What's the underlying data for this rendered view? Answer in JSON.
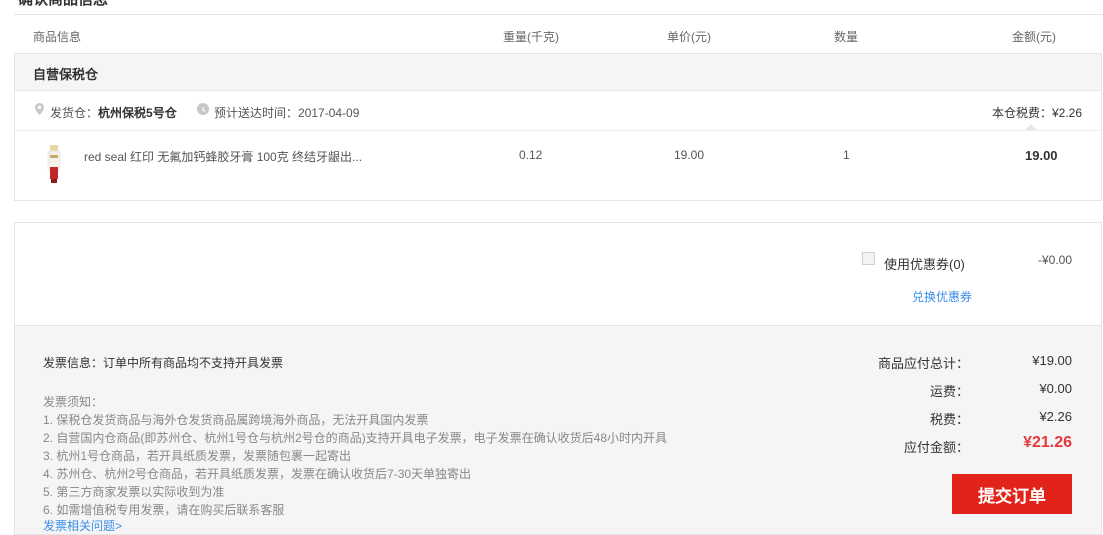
{
  "section": {
    "title": "确认商品信息"
  },
  "columns": {
    "product": "商品信息",
    "weight": "重量(千克)",
    "price": "单价(元)",
    "qty": "数量",
    "amount": "金额(元)"
  },
  "warehouse": {
    "name": "自营保税仓",
    "ship_from_label": "发货仓：",
    "ship_from_value": "杭州保税5号仓",
    "eta_label": "预计送达时间：",
    "eta_value": "2017-04-09",
    "tax_label": "本仓税费：",
    "tax_value": "¥2.26"
  },
  "product": {
    "name": "red seal 红印 无氟加钙蜂胶牙膏 100克 终结牙龈出...",
    "weight": "0.12",
    "price": "19.00",
    "qty": "1",
    "amount": "19.00"
  },
  "coupon": {
    "label": "使用优惠券(0)",
    "value": "-¥0.00",
    "exchange": "兑换优惠券"
  },
  "invoice": {
    "info": "发票信息：订单中所有商品均不支持开具发票",
    "notice_title": "发票须知：",
    "notices": [
      "1. 保税仓发货商品与海外仓发货商品属跨境海外商品，无法开具国内发票",
      "2. 自营国内仓商品(即苏州仓、杭州1号仓与杭州2号仓的商品)支持开具电子发票，电子发票在确认收货后48小时内开具",
      "3. 杭州1号仓商品，若开具纸质发票，发票随包裹一起寄出",
      "4. 苏州仓、杭州2号仓商品，若开具纸质发票，发票在确认收货后7-30天单独寄出",
      "5. 第三方商家发票以实际收到为准",
      "6. 如需增值税专用发票，请在购买后联系客服"
    ],
    "link": "发票相关问题>"
  },
  "summary": {
    "goods_label": "商品应付总计：",
    "goods_value": "¥19.00",
    "shipping_label": "运费：",
    "shipping_value": "¥0.00",
    "tax_label": "税费：",
    "tax_value": "¥2.26",
    "due_label": "应付金额：",
    "due_value": "¥21.26"
  },
  "submit_label": "提交订单",
  "colors": {
    "accent_red": "#e2231a",
    "price_red": "#e4393c",
    "link_blue": "#3a8ee6"
  },
  "icons": {
    "location": "location-pin-icon",
    "time": "clock-icon",
    "checkbox": "checkbox-icon"
  }
}
